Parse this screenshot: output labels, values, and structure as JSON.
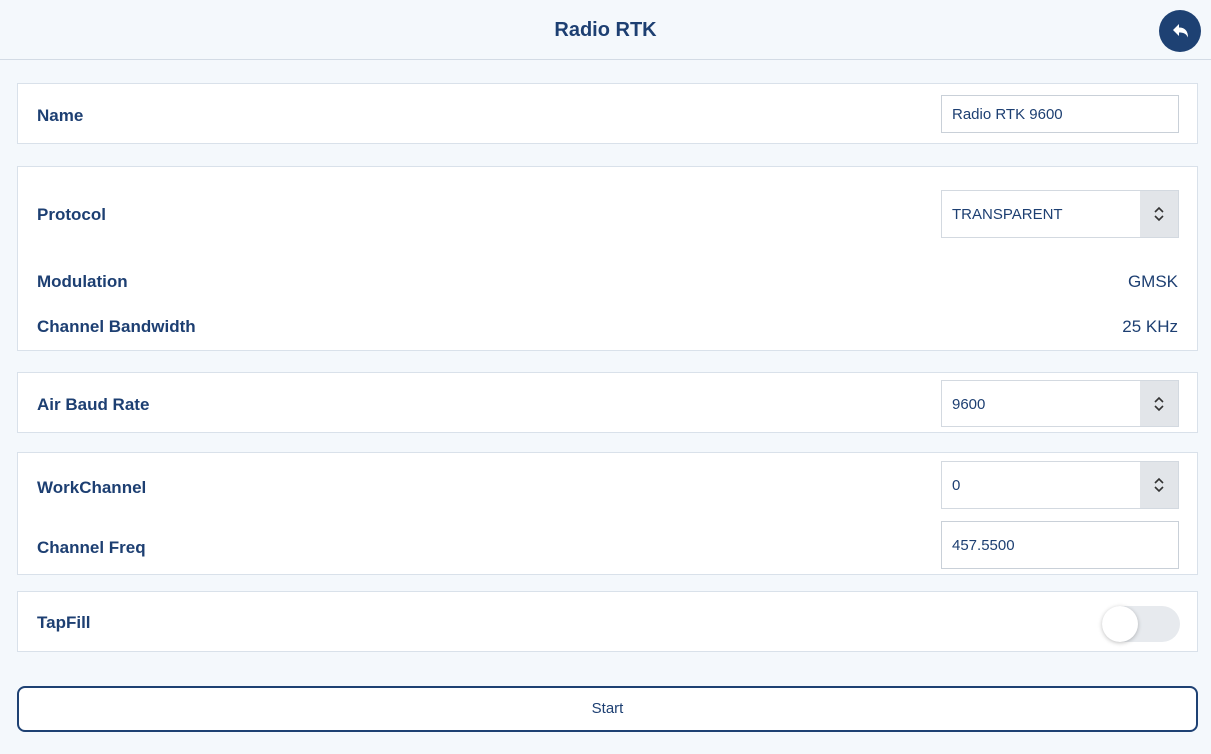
{
  "header": {
    "title": "Radio RTK",
    "back_icon": "back-arrow-icon"
  },
  "name_section": {
    "label": "Name",
    "value": "Radio RTK 9600"
  },
  "protocol_section": {
    "protocol_label": "Protocol",
    "protocol_value": "TRANSPARENT",
    "modulation_label": "Modulation",
    "modulation_value": "GMSK",
    "bandwidth_label": "Channel Bandwidth",
    "bandwidth_value": "25 KHz"
  },
  "baud_section": {
    "label": "Air Baud Rate",
    "value": "9600"
  },
  "channel_section": {
    "work_channel_label": "WorkChannel",
    "work_channel_value": "0",
    "freq_label": "Channel Freq",
    "freq_value": "457.5500"
  },
  "tapfill_section": {
    "label": "TapFill",
    "enabled": false
  },
  "start_button": {
    "label": "Start"
  },
  "colors": {
    "text": "#1d3f72",
    "accent": "#1e4173",
    "background": "#f4f8fc",
    "card": "#ffffff"
  }
}
